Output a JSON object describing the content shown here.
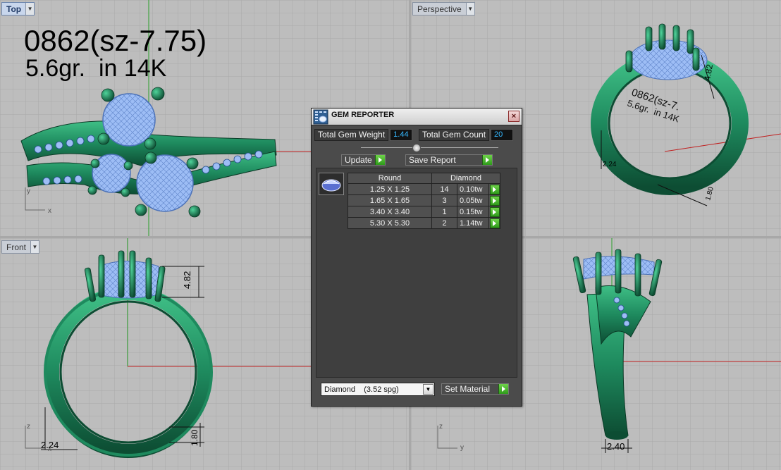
{
  "viewports": {
    "top": {
      "label": "Top",
      "title_line1": "0862(sz-7.75)",
      "title_line2": "5.6gr.  in 14K",
      "axis_y": "y",
      "axis_x": "x"
    },
    "perspective": {
      "label": "Perspective",
      "dim_a": "4.82",
      "dim_b": "2.24",
      "dim_c": "1.80",
      "engraving_line1": "0862(sz-7.",
      "engraving_line2": "5.6gr.  in 14K"
    },
    "front": {
      "label": "Front",
      "dim_height": "4.82",
      "dim_width": "2.24",
      "dim_bottom": "1.80",
      "axis_z": "z",
      "axis_x": "x"
    },
    "right": {
      "dim_width": "2.40",
      "axis_z": "z",
      "axis_y": "y"
    }
  },
  "panel": {
    "title": "GEM REPORTER",
    "close_label": "×",
    "total_weight_label": "Total Gem Weight",
    "total_weight_value": "1.44",
    "total_count_label": "Total Gem Count",
    "total_count_value": "20",
    "update_label": "Update",
    "save_label": "Save Report",
    "table_headers": [
      "Round",
      "Diamond"
    ],
    "rows": [
      {
        "size": "1.25 X 1.25",
        "count": "14",
        "weight": "0.10tw"
      },
      {
        "size": "1.65 X 1.65",
        "count": "3",
        "weight": "0.05tw"
      },
      {
        "size": "3.40 X 3.40",
        "count": "1",
        "weight": "0.15tw"
      },
      {
        "size": "5.30 X 5.30",
        "count": "2",
        "weight": "1.14tw"
      }
    ],
    "material_select": "Diamond    (3.52 spg)",
    "set_material_label": "Set Material"
  },
  "colors": {
    "metal": "#1e8a5e",
    "metal_dark": "#0f5a3a",
    "gem": "#8fb4f2",
    "axis_red": "#c02020",
    "axis_green": "#208a20"
  }
}
